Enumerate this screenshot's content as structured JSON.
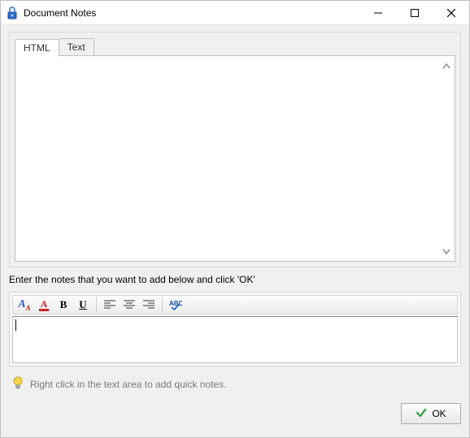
{
  "window": {
    "title": "Document Notes"
  },
  "tabs": {
    "html": "HTML",
    "text": "Text"
  },
  "instruction": "Enter the notes that you want to add below and click 'OK'",
  "toolbar": {
    "font_letter": "A",
    "font_color_letter": "A",
    "bold": "B",
    "underline": "U"
  },
  "editor": {
    "value": ""
  },
  "tip": "Right click in the text area to add quick notes.",
  "buttons": {
    "ok": "OK"
  }
}
